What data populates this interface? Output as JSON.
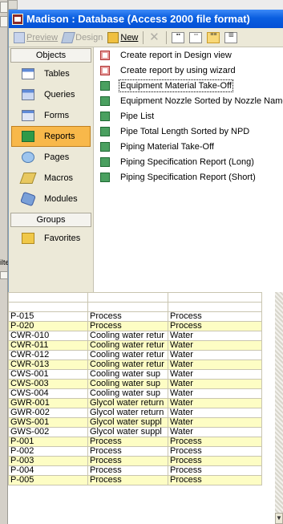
{
  "window": {
    "title": "Madison : Database (Access 2000 file format)"
  },
  "toolbar": {
    "preview_label": "Preview",
    "design_label": "Design",
    "new_label": "New"
  },
  "objects": {
    "header": "Objects",
    "items": [
      {
        "label": "Tables",
        "icon": "tables-icon"
      },
      {
        "label": "Queries",
        "icon": "queries-icon"
      },
      {
        "label": "Forms",
        "icon": "forms-icon"
      },
      {
        "label": "Reports",
        "icon": "reports-icon",
        "selected": true
      },
      {
        "label": "Pages",
        "icon": "pages-icon"
      },
      {
        "label": "Macros",
        "icon": "macros-icon"
      },
      {
        "label": "Modules",
        "icon": "modules-icon"
      }
    ],
    "groups_header": "Groups",
    "groups": [
      {
        "label": "Favorites",
        "icon": "favorites-icon"
      }
    ]
  },
  "reports": [
    "Create report in Design view",
    "Create report by using wizard",
    "Equipment Material Take-Off",
    "Equipment Nozzle Sorted by Nozzle Name",
    "Pipe List",
    "Pipe Total Length Sorted by NPD",
    "Piping Material Take-Off",
    "Piping Specification Report (Long)",
    "Piping Specification Report (Short)"
  ],
  "background": {
    "cut_text": "ilte"
  },
  "grid": {
    "rows": [
      {
        "id": "P-015",
        "desc": "Process",
        "type": "Process",
        "hl": false
      },
      {
        "id": "P-020",
        "desc": "Process",
        "type": "Process",
        "hl": true
      },
      {
        "id": "CWR-010",
        "desc": "Cooling water retur",
        "type": "Water",
        "hl": false
      },
      {
        "id": "CWR-011",
        "desc": "Cooling water retur",
        "type": "Water",
        "hl": true
      },
      {
        "id": "CWR-012",
        "desc": "Cooling water retur",
        "type": "Water",
        "hl": false
      },
      {
        "id": "CWR-013",
        "desc": "Cooling water retur",
        "type": "Water",
        "hl": true
      },
      {
        "id": "CWS-001",
        "desc": "Cooling water sup",
        "type": "Water",
        "hl": false
      },
      {
        "id": "CWS-003",
        "desc": "Cooling water sup",
        "type": "Water",
        "hl": true
      },
      {
        "id": "CWS-004",
        "desc": "Cooling water sup",
        "type": "Water",
        "hl": false
      },
      {
        "id": "GWR-001",
        "desc": "Glycol water return",
        "type": "Water",
        "hl": true
      },
      {
        "id": "GWR-002",
        "desc": "Glycol water return",
        "type": "Water",
        "hl": false
      },
      {
        "id": "GWS-001",
        "desc": "Glycol water suppl",
        "type": "Water",
        "hl": true
      },
      {
        "id": "GWS-002",
        "desc": "Glycol water suppl",
        "type": "Water",
        "hl": false
      },
      {
        "id": "P-001",
        "desc": "Process",
        "type": "Process",
        "hl": true
      },
      {
        "id": "P-002",
        "desc": "Process",
        "type": "Process",
        "hl": false
      },
      {
        "id": "P-003",
        "desc": "Process",
        "type": "Process",
        "hl": true
      },
      {
        "id": "P-004",
        "desc": "Process",
        "type": "Process",
        "hl": false
      },
      {
        "id": "P-005",
        "desc": "Process",
        "type": "Process",
        "hl": true
      }
    ]
  },
  "colors": {
    "title_bar": "#0a5ee0",
    "selected_object": "#f8b84a",
    "row_highlight": "#fdfdc4"
  }
}
